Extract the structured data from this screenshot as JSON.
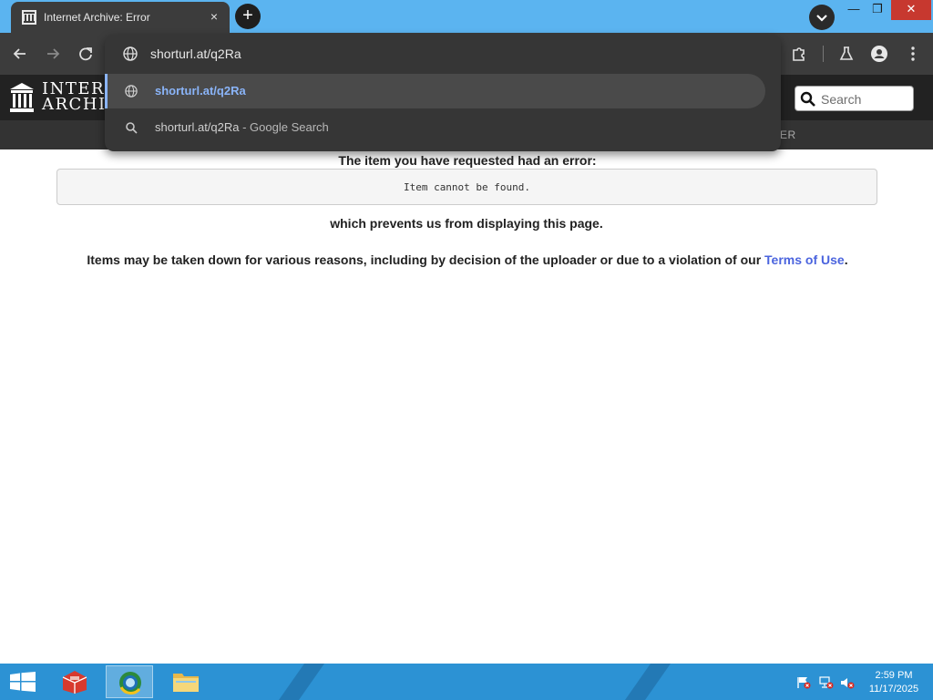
{
  "browser": {
    "tab_title": "Internet Archive: Error",
    "tab_close_glyph": "×",
    "new_tab_glyph": "+",
    "window_controls": {
      "minimize": "—",
      "maximize": "❐",
      "close": "✕"
    },
    "omnibox": {
      "input_text": "shorturl.at/q2Ra",
      "suggestions": [
        {
          "icon": "globe-icon",
          "text": "shorturl.at/q2Ra",
          "suffix": ""
        },
        {
          "icon": "search-icon",
          "text": "shorturl.at/q2Ra",
          "suffix": " - Google Search"
        }
      ]
    },
    "colors": {
      "tab_strip": "#5bb4f0",
      "toolbar": "#3c3c3c",
      "suggestion_link": "#8ab4f8"
    }
  },
  "site": {
    "logo_line1": "INTERNET",
    "logo_line2": "ARCHIVE",
    "search_placeholder": "Search",
    "nav_peek": "ER"
  },
  "error": {
    "heading": "The item you have requested had an error:",
    "code": "Item cannot be found.",
    "prevents": "which prevents us from displaying this page.",
    "reasons_prefix": "Items may be taken down for various reasons, including by decision of the uploader or due to a violation of our ",
    "terms_link": "Terms of Use",
    "reasons_suffix": "."
  },
  "taskbar": {
    "clock_time": "2:59 PM",
    "clock_date": "11/17/2025",
    "apps": [
      "toolbox-icon",
      "browser-icon",
      "file-explorer-icon"
    ],
    "tray": [
      "flag-alert-icon",
      "network-alert-icon",
      "volume-muted-icon"
    ],
    "color": "#2c92d4"
  }
}
